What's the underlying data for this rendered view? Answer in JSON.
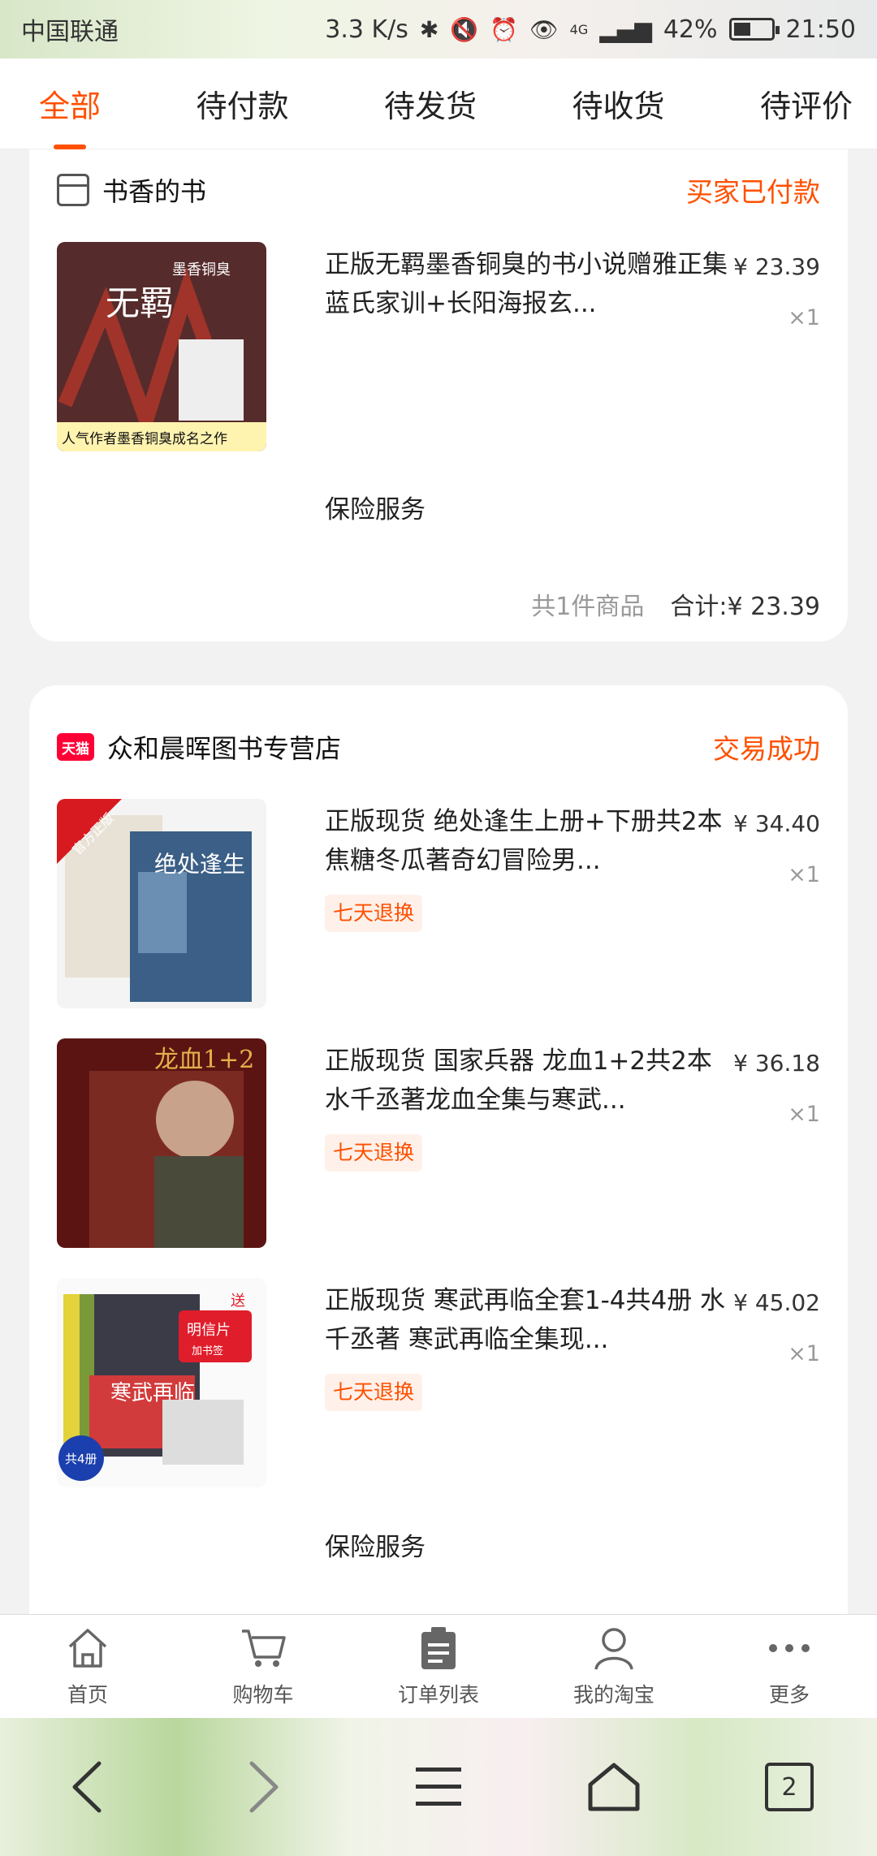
{
  "status_bar": {
    "carrier": "中国联通",
    "net_speed": "3.3 K/s",
    "network": "4G",
    "battery": "42%",
    "time": "21:50"
  },
  "tabs": [
    {
      "label": "全部",
      "active": true
    },
    {
      "label": "待付款",
      "active": false
    },
    {
      "label": "待发货",
      "active": false
    },
    {
      "label": "待收货",
      "active": false
    },
    {
      "label": "待评价",
      "active": false
    }
  ],
  "orders": [
    {
      "shop_icon": "store-icon",
      "shop_name": "书香的书",
      "status": "买家已付款",
      "items": [
        {
          "title": "正版无羁墨香铜臭的书小说赠雅正集蓝氏家训+长阳海报玄...",
          "price": "¥ 23.39",
          "qty": "×1",
          "cover_text": "无羁",
          "cover_author": "墨香铜臭",
          "cover_caption": "人气作者墨香铜臭成名之作"
        }
      ],
      "insurance": "保险服务",
      "count": "共1件商品",
      "total": "合计:¥ 23.39"
    },
    {
      "shop_icon": "tmall-icon",
      "shop_icon_text": "天猫",
      "shop_name": "众和晨晖图书专营店",
      "status": "交易成功",
      "items": [
        {
          "title": "正版现货 绝处逢生上册+下册共2本 焦糖冬瓜著奇幻冒险男...",
          "price": "¥ 34.40",
          "qty": "×1",
          "tag": "七天退换",
          "cover_text": "绝处逢生",
          "cover_badge": "官方正版"
        },
        {
          "title": "正版现货 国家兵器 龙血1+2共2本 水千丞著龙血全集与寒武...",
          "price": "¥ 36.18",
          "qty": "×1",
          "tag": "七天退换",
          "cover_text": "龙血1+2"
        },
        {
          "title": "正版现货 寒武再临全套1-4共4册 水千丞著 寒武再临全集现...",
          "price": "¥ 45.02",
          "qty": "×1",
          "tag": "七天退换",
          "cover_text": "寒武再临",
          "cover_badge": "共4册",
          "cover_promo": "送",
          "cover_promo2": "明信片",
          "cover_promo3": "加书签"
        }
      ],
      "insurance": "保险服务"
    }
  ],
  "bottom_nav": [
    {
      "label": "首页",
      "icon": "home-icon"
    },
    {
      "label": "购物车",
      "icon": "cart-icon"
    },
    {
      "label": "订单列表",
      "icon": "order-list-icon"
    },
    {
      "label": "我的淘宝",
      "icon": "profile-icon"
    },
    {
      "label": "更多",
      "icon": "more-icon"
    }
  ],
  "system_nav": {
    "tabs_count": "2"
  },
  "colors": {
    "accent": "#ff5000",
    "tmall": "#ff0036"
  }
}
